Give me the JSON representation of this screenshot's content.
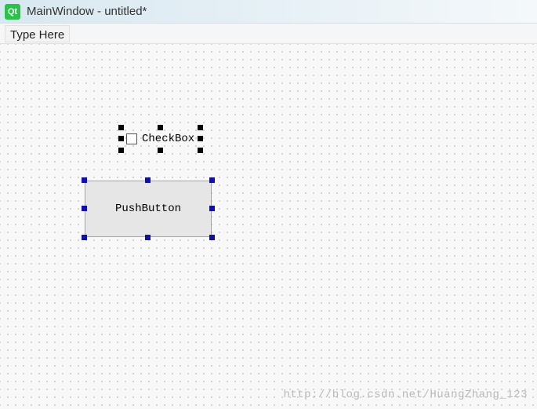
{
  "window": {
    "title": "MainWindow - untitled*",
    "logo_text": "Qt"
  },
  "menubar": {
    "placeholder": "Type Here"
  },
  "widgets": {
    "checkbox": {
      "label": "CheckBox",
      "selected": true,
      "handle_color": "black"
    },
    "pushbutton": {
      "label": "PushButton",
      "selected": true,
      "handle_color": "blue"
    }
  },
  "watermark": "http://blog.csdn.net/HuangZhang_123"
}
